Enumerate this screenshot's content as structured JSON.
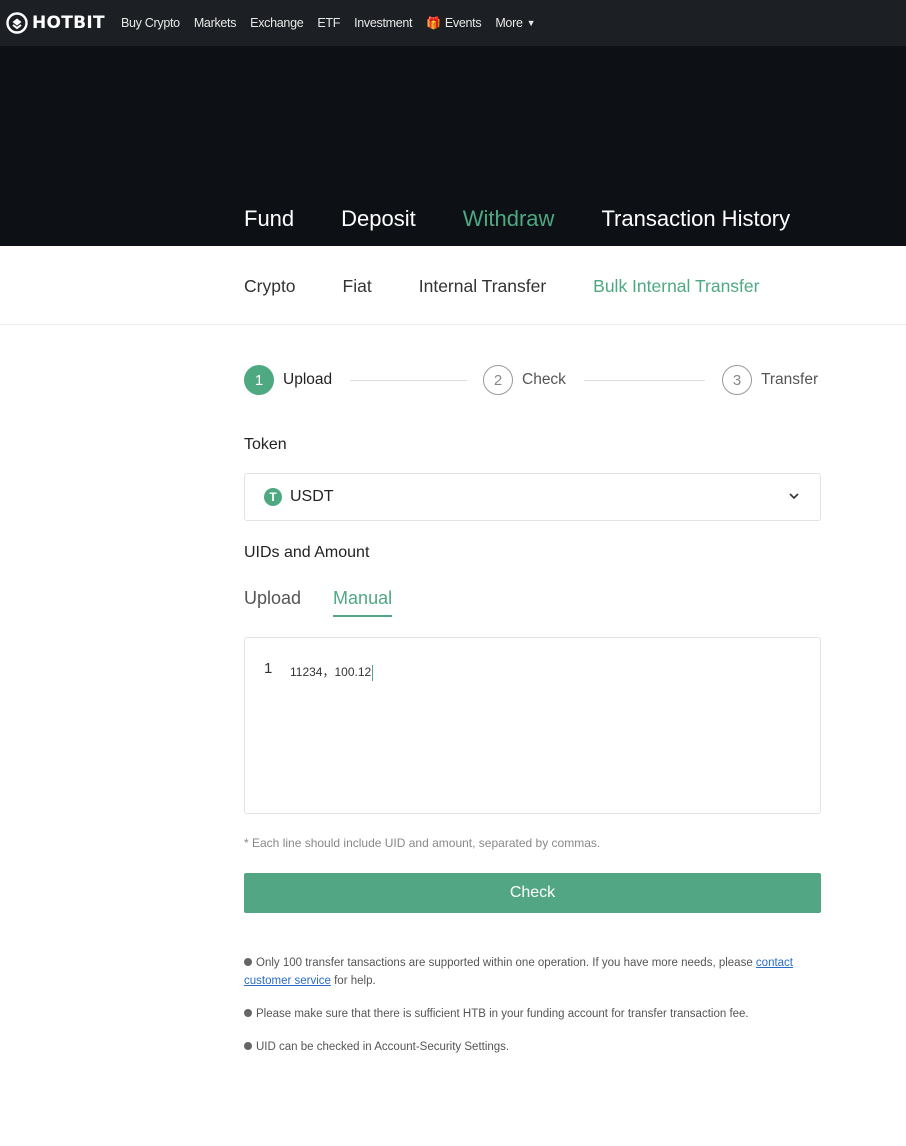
{
  "brand": {
    "name": "HOTBIT",
    "accent": "#4ea882"
  },
  "nav": {
    "items": [
      {
        "label": "Buy Crypto"
      },
      {
        "label": "Markets"
      },
      {
        "label": "Exchange"
      },
      {
        "label": "ETF"
      },
      {
        "label": "Investment"
      },
      {
        "label": "Events",
        "icon": "gift-icon"
      },
      {
        "label": "More",
        "icon": "caret-down-icon"
      }
    ]
  },
  "main_tabs": [
    {
      "label": "Fund",
      "active": false
    },
    {
      "label": "Deposit",
      "active": false
    },
    {
      "label": "Withdraw",
      "active": true
    },
    {
      "label": "Transaction History",
      "active": false
    }
  ],
  "sub_tabs": [
    {
      "label": "Crypto",
      "active": false
    },
    {
      "label": "Fiat",
      "active": false
    },
    {
      "label": "Internal Transfer",
      "active": false
    },
    {
      "label": "Bulk Internal Transfer",
      "active": true
    }
  ],
  "steps": [
    {
      "number": "1",
      "label": "Upload",
      "active": true
    },
    {
      "number": "2",
      "label": "Check",
      "active": false
    },
    {
      "number": "3",
      "label": "Transfer",
      "active": false
    }
  ],
  "form": {
    "token_label": "Token",
    "token_value": "USDT",
    "token_icon_glyph": "T",
    "uids_label": "UIDs and Amount",
    "mode_tabs": [
      {
        "label": "Upload",
        "active": false
      },
      {
        "label": "Manual",
        "active": true
      }
    ],
    "editor": {
      "line_number": "1",
      "line_text": "11234，100.12"
    },
    "hint": "* Each line should include UID and amount, separated by commas.",
    "check_button": "Check"
  },
  "notes": {
    "note1_text": "Only 100 transfer tansactions are supported within one operation. If you have more needs, please",
    "note1_link": "contact customer service",
    "note1_suffix": " for help.",
    "note2": "Please make sure that there is sufficient HTB in your funding account for transfer transaction fee.",
    "note3": "UID can be checked in Account-Security Settings."
  }
}
